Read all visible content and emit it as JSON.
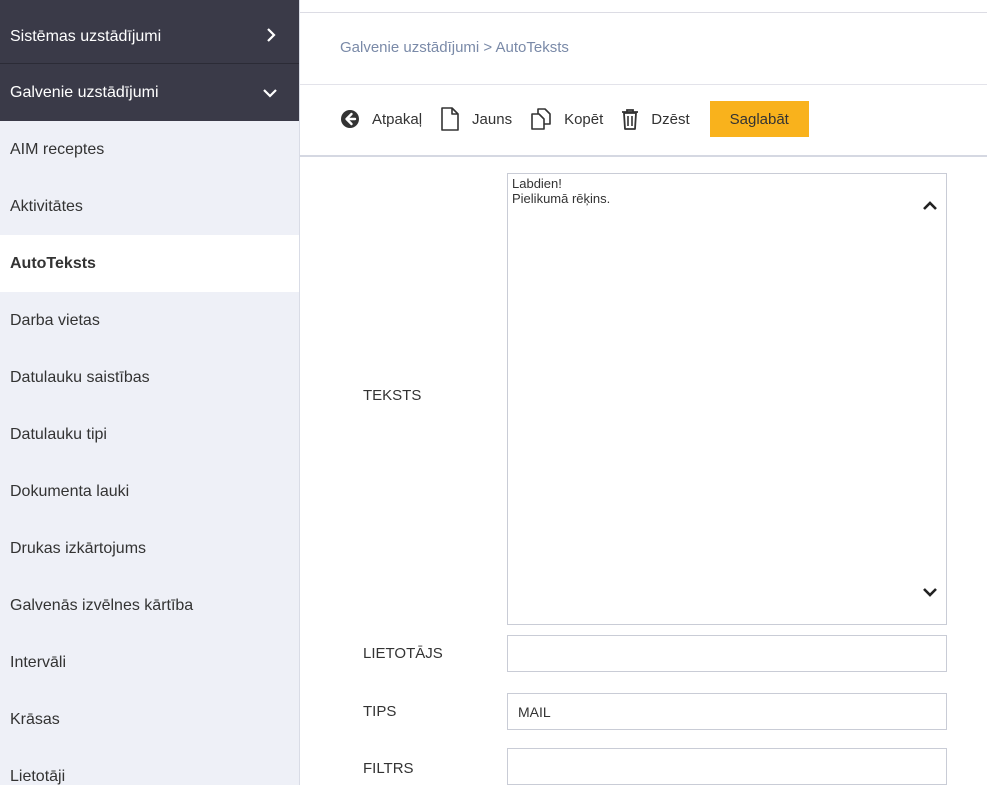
{
  "sidebar": {
    "sections": [
      {
        "label": "Sistēmas uzstādījumi",
        "chevron": ">"
      },
      {
        "label": "Galvenie uzstādījumi",
        "chevron": "⌄"
      }
    ],
    "items": [
      {
        "label": "AIM receptes"
      },
      {
        "label": "Aktivitātes"
      },
      {
        "label": "AutoTeksts",
        "active": true
      },
      {
        "label": "Darba vietas"
      },
      {
        "label": "Datulauku saistības"
      },
      {
        "label": "Datulauku tipi"
      },
      {
        "label": "Dokumenta lauki"
      },
      {
        "label": "Drukas izkārtojums"
      },
      {
        "label": "Galvenās izvēlnes kārtība"
      },
      {
        "label": "Intervāli"
      },
      {
        "label": "Krāsas"
      },
      {
        "label": "Lietotāji"
      }
    ]
  },
  "breadcrumb": {
    "parent": "Galvenie uzstādījumi",
    "separator": " > ",
    "current": "AutoTeksts"
  },
  "toolbar": {
    "back_label": "Atpakaļ",
    "new_label": "Jauns",
    "copy_label": "Kopēt",
    "delete_label": "Dzēst",
    "save_label": "Saglabāt",
    "save_color": "#f9b21c"
  },
  "form": {
    "teksts_label": "TEKSTS",
    "teksts_lines": [
      "Labdien!",
      "Pielikumā rēķins."
    ],
    "lietotajs_label": "LIETOTĀJS",
    "lietotajs_value": "",
    "tips_label": "TIPS",
    "tips_value": "MAIL",
    "filtrs_label": "FILTRS",
    "filtrs_value": ""
  },
  "colors": {
    "sidebar_dark": "#3a3a48",
    "sidebar_bg": "#eef0f7",
    "breadcrumb_text": "#7a8aa8"
  }
}
